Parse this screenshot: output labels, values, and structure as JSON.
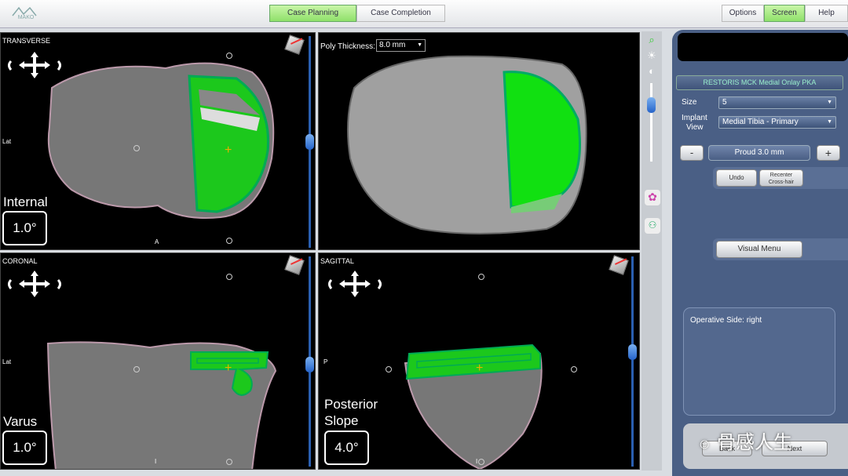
{
  "header": {
    "logo": "MAKO",
    "tabs": [
      {
        "label": "Case Planning",
        "active": true
      },
      {
        "label": "Case Completion",
        "active": false
      }
    ],
    "right_tabs": [
      {
        "label": "Options",
        "active": false
      },
      {
        "label": "Screen",
        "active": true
      },
      {
        "label": "Help",
        "active": false
      }
    ]
  },
  "views": {
    "transverse": {
      "title": "TRANSVERSE",
      "side": "Lat",
      "bottom": "A",
      "mode": "Internal",
      "value": "1.0°"
    },
    "three_d": {
      "poly_label": "Poly Thickness:",
      "poly_value": "8.0 mm"
    },
    "coronal": {
      "title": "CORONAL",
      "side": "Lat",
      "bottom": "I",
      "mode": "Varus",
      "value": "1.0°"
    },
    "sagittal": {
      "title": "SAGITTAL",
      "side": "P",
      "bottom": "I",
      "mode_line1": "Posterior",
      "mode_line2": "Slope",
      "value": "4.0°"
    }
  },
  "panel": {
    "product": "RESTORIS MCK Medial Onlay PKA",
    "size_label": "Size",
    "size_value": "5",
    "implant_label_1": "Implant",
    "implant_label_2": "View",
    "implant_value": "Medial Tibia - Primary",
    "minus": "-",
    "proud": "Proud 3.0 mm",
    "plus": "+",
    "undo": "Undo",
    "recenter_1": "Recenter",
    "recenter_2": "Cross-hair",
    "visual_menu": "Visual Menu",
    "operative_side": "Operative Side: right",
    "back": "Back",
    "next": "Next"
  },
  "watermark": "骨感人生",
  "colors": {
    "implant": "#20e020",
    "scroll": "#2563c9",
    "panel": "#4a5f85",
    "active_tab": "#8fe06a"
  },
  "icons": [
    "zoom-icon",
    "brightness-icon",
    "contrast-icon",
    "color-wheel-icon",
    "knee-icon"
  ]
}
